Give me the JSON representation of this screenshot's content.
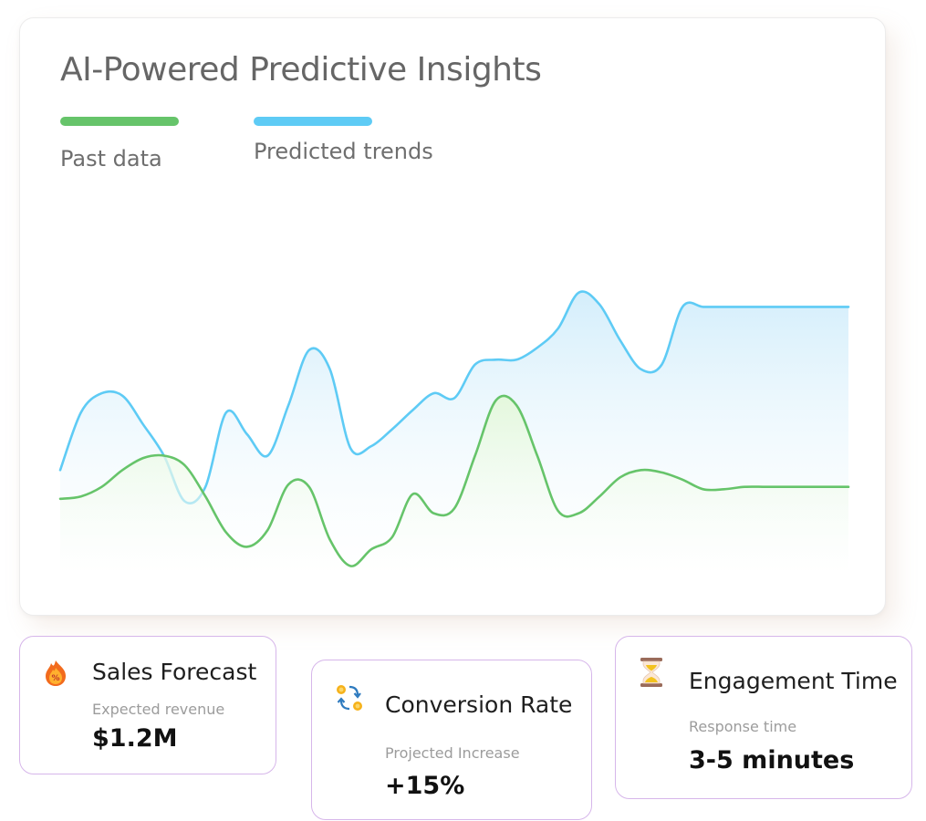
{
  "chart_data": {
    "type": "area",
    "title": "AI-Powered Predictive Insights",
    "x": [
      0,
      1,
      2,
      3,
      4,
      5,
      6,
      7,
      8,
      9,
      10,
      11,
      12,
      13,
      14,
      15,
      16,
      17,
      18,
      19,
      20,
      21,
      22,
      23,
      24,
      25,
      26,
      27,
      28,
      29,
      30,
      31,
      32,
      33,
      34,
      35,
      36,
      37,
      38
    ],
    "grid": false,
    "legend_position": "top-left",
    "ylim": [
      0,
      100
    ],
    "xlim": [
      0,
      38
    ],
    "series": [
      {
        "name": "Past data",
        "color": "#66c46a",
        "fill": "#e8f8e0",
        "values": [
          32,
          33,
          37,
          44,
          49,
          50,
          46,
          33,
          18,
          12,
          19,
          38,
          37,
          15,
          4,
          11,
          16,
          34,
          26,
          28,
          50,
          73,
          71,
          50,
          27,
          26,
          33,
          41,
          44,
          43,
          40,
          36,
          36,
          37,
          37,
          37,
          37,
          37,
          37
        ]
      },
      {
        "name": "Predicted trends",
        "color": "#5ecbf5",
        "fill": "#dcf1fb",
        "values": [
          44,
          68,
          76,
          75,
          63,
          50,
          31,
          37,
          68,
          59,
          50,
          71,
          94,
          86,
          53,
          54,
          61,
          69,
          76,
          74,
          88,
          90,
          90,
          95,
          103,
          118,
          113,
          98,
          86,
          88,
          112,
          112,
          112,
          112,
          112,
          112,
          112,
          112,
          112
        ]
      }
    ]
  },
  "legend": [
    {
      "label": "Past data",
      "color": "#66c46a"
    },
    {
      "label": "Predicted trends",
      "color": "#5ecbf5"
    }
  ],
  "stats": [
    {
      "icon": "fire-percent-icon",
      "title": "Sales Forecast",
      "subtitle": "Expected revenue",
      "value": "$1.2M"
    },
    {
      "icon": "exchange-coins-icon",
      "title": "Conversion Rate",
      "subtitle": "Projected Increase",
      "value": "+15%"
    },
    {
      "icon": "hourglass-icon",
      "title": "Engagement Time",
      "subtitle": "Response time",
      "value": "3-5 minutes"
    }
  ]
}
